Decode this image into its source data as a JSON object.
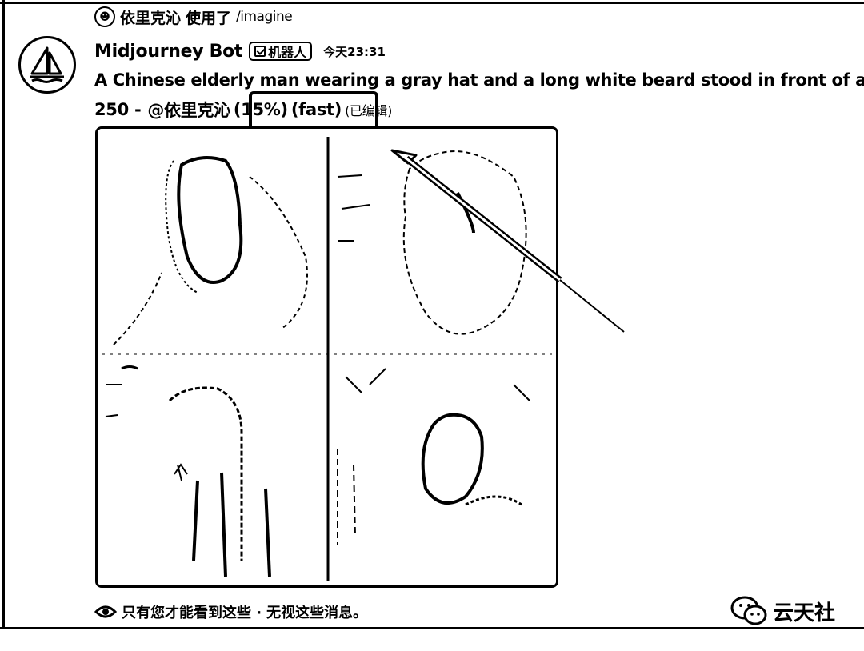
{
  "reply": {
    "user": "依里克沁",
    "used_label": "使用了",
    "command": "/imagine"
  },
  "message": {
    "bot_name": "Midjourney Bot",
    "bot_badge": "机器人",
    "timestamp": "今天23:31",
    "prompt": "A Chinese elderly man wearing a gray hat and a long white beard stood in front of a",
    "status_prefix": "250 -",
    "status_mention": "@依里克沁",
    "status_progress": "(15%)",
    "status_speed": "(fast)",
    "status_edited": "(已编辑)",
    "progress_percent": 15
  },
  "ephemeral": {
    "notice": "只有您才能看到这些 ·",
    "dismiss": "无视这些消息。"
  },
  "watermark": {
    "text": "云天社"
  },
  "icons": {
    "reply_avatar": "user-avatar-icon",
    "bot_avatar": "sailboat-logo-icon",
    "badge": "checkmark-icon",
    "notice": "eye-icon",
    "watermark": "wechat-icon",
    "annotation": "arrow-icon"
  }
}
